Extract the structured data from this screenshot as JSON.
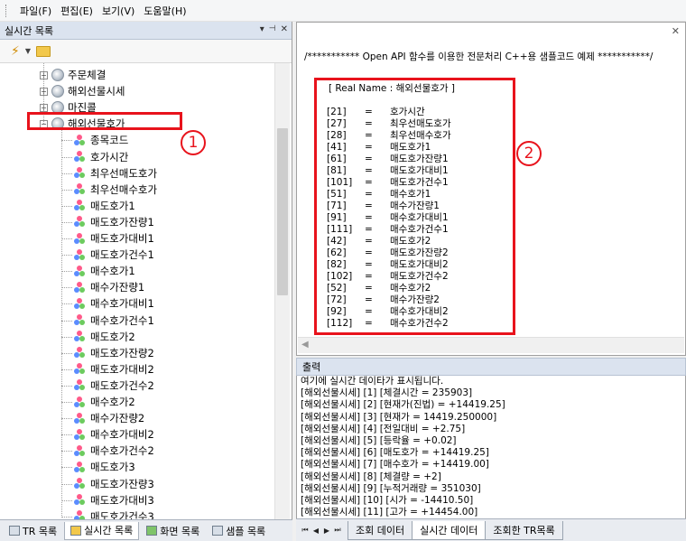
{
  "menu": {
    "items": [
      "파일(F)",
      "편집(E)",
      "보기(V)",
      "도움말(H)"
    ]
  },
  "left_panel": {
    "title": "실시간 목록",
    "header_buttons": [
      "▾",
      "📌",
      "✕"
    ],
    "tree": {
      "groups": [
        {
          "label": "주문체결",
          "expander": "+"
        },
        {
          "label": "해외선물시세",
          "expander": "+"
        },
        {
          "label": "마진콜",
          "expander": "+"
        },
        {
          "label": "해외선물호가",
          "expander": "−"
        }
      ],
      "fields": [
        "종목코드",
        "호가시간",
        "최우선매도호가",
        "최우선매수호가",
        "매도호가1",
        "매도호가잔량1",
        "매도호가대비1",
        "매도호가건수1",
        "매수호가1",
        "매수가잔량1",
        "매수호가대비1",
        "매수호가건수1",
        "매도호가2",
        "매도호가잔량2",
        "매도호가대비2",
        "매도호가건수2",
        "매수호가2",
        "매수가잔량2",
        "매수호가대비2",
        "매수호가건수2",
        "매도호가3",
        "매도호가잔량3",
        "매도호가대비3",
        "매도호가건수3"
      ]
    },
    "badge": "1",
    "tabs": [
      "TR 목록",
      "실시간 목록",
      "화면 목록",
      "샘플 목록"
    ],
    "active_tab": "실시간 목록"
  },
  "code_panel": {
    "header": "/*********** Open API 함수를 이용한 전문처리 C++용 샘플코드 예제 ***********/",
    "real_name": "[ Real Name : 해외선물호가 ]",
    "badge": "2",
    "lines": [
      {
        "code": "[21]",
        "eq": "=",
        "name": "호가시간"
      },
      {
        "code": "[27]",
        "eq": "=",
        "name": "최우선매도호가"
      },
      {
        "code": "[28]",
        "eq": "=",
        "name": "최우선매수호가"
      },
      {
        "code": "[41]",
        "eq": "=",
        "name": "매도호가1"
      },
      {
        "code": "[61]",
        "eq": "=",
        "name": "매도호가잔량1"
      },
      {
        "code": "[81]",
        "eq": "=",
        "name": "매도호가대비1"
      },
      {
        "code": "[101]",
        "eq": "=",
        "name": "매도호가건수1"
      },
      {
        "code": "[51]",
        "eq": "=",
        "name": "매수호가1"
      },
      {
        "code": "[71]",
        "eq": "=",
        "name": "매수가잔량1"
      },
      {
        "code": "[91]",
        "eq": "=",
        "name": "매수호가대비1"
      },
      {
        "code": "[111]",
        "eq": "=",
        "name": "매수호가건수1"
      },
      {
        "code": "[42]",
        "eq": "=",
        "name": "매도호가2"
      },
      {
        "code": "[62]",
        "eq": "=",
        "name": "매도호가잔량2"
      },
      {
        "code": "[82]",
        "eq": "=",
        "name": "매도호가대비2"
      },
      {
        "code": "[102]",
        "eq": "=",
        "name": "매도호가건수2"
      },
      {
        "code": "[52]",
        "eq": "=",
        "name": "매수호가2"
      },
      {
        "code": "[72]",
        "eq": "=",
        "name": "매수가잔량2"
      },
      {
        "code": "[92]",
        "eq": "=",
        "name": "매수호가대비2"
      },
      {
        "code": "[112]",
        "eq": "=",
        "name": "매수호가건수2"
      }
    ]
  },
  "output": {
    "title": "출력",
    "lines": [
      "여기에 실시간 데이타가 표시됩니다.",
      "[해외선물시세] [1] [체결시간 = 235903]",
      "[해외선물시세] [2] [현재가(진법) = +14419.25]",
      "[해외선물시세] [3] [현재가 = 14419.250000]",
      "[해외선물시세] [4] [전일대비 = +2.75]",
      "[해외선물시세] [5] [등락율 = +0.02]",
      "[해외선물시세] [6] [매도호가 = +14419.25]",
      "[해외선물시세] [7] [매수호가 = +14419.00]",
      "[해외선물시세] [8] [체결량 = +2]",
      "[해외선물시세] [9] [누적거래량 = 351030]",
      "[해외선물시세] [10] [시가 = -14410.50]",
      "[해외선물시세] [11] [고가 = +14454.00]"
    ],
    "tabs": [
      "조회 데이터",
      "실시간 데이터",
      "조회한 TR목록"
    ],
    "active_tab": "실시간 데이터"
  }
}
